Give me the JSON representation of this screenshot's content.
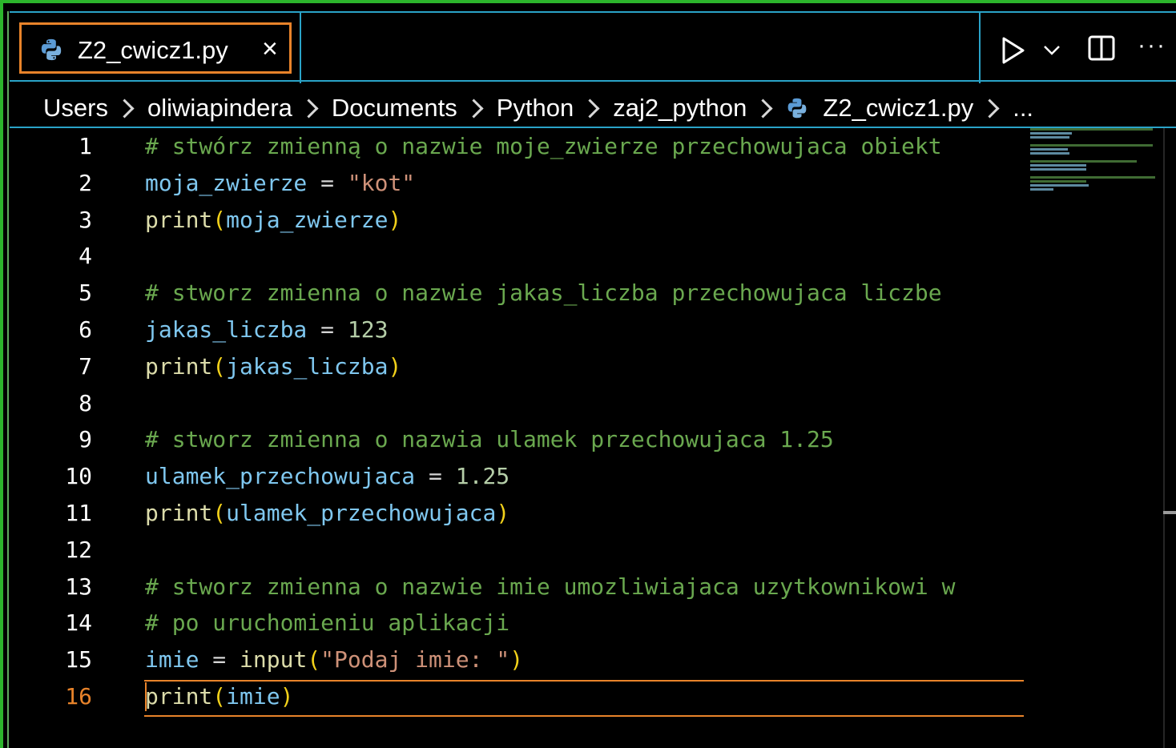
{
  "tab": {
    "label": "Z2_cwicz1.py",
    "icon": "python-icon",
    "close": "×"
  },
  "toolbar": {
    "run_icon": "run-icon",
    "dropdown_icon": "chevron-down-icon",
    "split_icon": "split-editor-icon",
    "more": "···"
  },
  "breadcrumb": [
    "Users",
    "oliwiapindera",
    "Documents",
    "Python",
    "zaj2_python",
    "Z2_cwicz1.py",
    "..."
  ],
  "lines": [
    {
      "n": "1",
      "code": "# stwórz zmienną o nazwie moje_zwierze przechowujaca obiekt"
    },
    {
      "n": "2",
      "code": "moja_zwierze = \"kot\""
    },
    {
      "n": "3",
      "code": "print(moja_zwierze)"
    },
    {
      "n": "4",
      "code": ""
    },
    {
      "n": "5",
      "code": "# stworz zmienna o nazwie jakas_liczba przechowujaca liczbe"
    },
    {
      "n": "6",
      "code": "jakas_liczba = 123"
    },
    {
      "n": "7",
      "code": "print(jakas_liczba)"
    },
    {
      "n": "8",
      "code": ""
    },
    {
      "n": "9",
      "code": "# stworz zmienna o nazwia ulamek przechowujaca 1.25"
    },
    {
      "n": "10",
      "code": "ulamek_przechowujaca = 1.25"
    },
    {
      "n": "11",
      "code": "print(ulamek_przechowujaca)"
    },
    {
      "n": "12",
      "code": ""
    },
    {
      "n": "13",
      "code": "# stworz zmienna o nazwie imie umozliwiajaca uzytkownikowi w"
    },
    {
      "n": "14",
      "code": "# po uruchomieniu aplikacji"
    },
    {
      "n": "15",
      "code": "imie = input(\"Podaj imie: \")"
    },
    {
      "n": "16",
      "code": "print(imie)"
    }
  ],
  "current_line": "16",
  "colors": {
    "accent": "#e8832a",
    "comment": "#6aa84f",
    "variable": "#7fc7ef",
    "function": "#dcdcaa",
    "string": "#ce9178",
    "bracket": "#f2d11a",
    "border": "#2aa3c8"
  }
}
